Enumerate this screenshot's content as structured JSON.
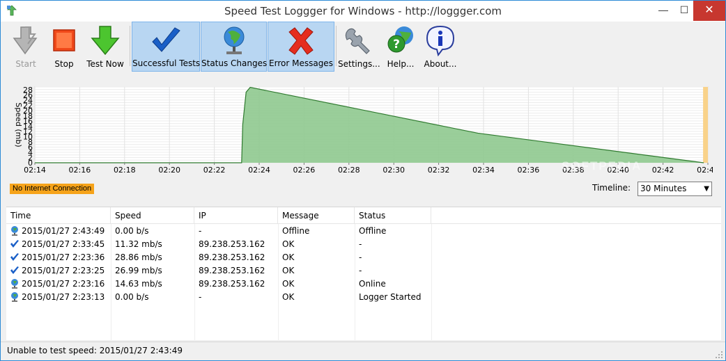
{
  "window": {
    "title": "Speed Test Loggger for Windows - http://loggger.com",
    "min_glyph": "—",
    "max_glyph": "☐",
    "close_glyph": "✕"
  },
  "toolbar": {
    "buttons": [
      {
        "label": "Start",
        "icon": "start-arrow-icon",
        "state": "disabled"
      },
      {
        "label": "Stop",
        "icon": "stop-square-icon",
        "state": "normal"
      },
      {
        "label": "Test Now",
        "icon": "test-now-arrow-icon",
        "state": "normal"
      },
      {
        "label": "Successful Tests",
        "icon": "checkmark-icon",
        "state": "pressed"
      },
      {
        "label": "Status Changes",
        "icon": "globe-network-icon",
        "state": "pressed"
      },
      {
        "label": "Error Messages",
        "icon": "error-x-icon",
        "state": "pressed"
      },
      {
        "label": "Settings...",
        "icon": "wrench-icon",
        "state": "normal"
      },
      {
        "label": "Help...",
        "icon": "help-globe-icon",
        "state": "normal"
      },
      {
        "label": "About...",
        "icon": "info-bubble-icon",
        "state": "normal"
      }
    ]
  },
  "chart_data": {
    "type": "area",
    "ylabel": "Speed (mb)",
    "xlabel": "",
    "y_ticks": [
      0,
      2,
      4,
      6,
      8,
      10,
      12,
      14,
      16,
      18,
      20,
      22,
      24,
      26,
      28
    ],
    "ylim": [
      0,
      29
    ],
    "x_ticks": [
      "02:14",
      "02:16",
      "02:18",
      "02:20",
      "02:22",
      "02:24",
      "02:26",
      "02:28",
      "02:30",
      "02:32",
      "02:34",
      "02:36",
      "02:38",
      "02:40",
      "02:42",
      "02:44"
    ],
    "xlim": [
      "02:14",
      "02:44"
    ],
    "series": [
      {
        "x": [
          "02:14",
          "02:23:13",
          "02:23:16",
          "02:23:25",
          "02:23:36",
          "02:33:45",
          "02:43:49"
        ],
        "y": [
          0,
          0,
          14.63,
          26.99,
          28.86,
          11.32,
          0
        ]
      }
    ],
    "fill_color": "#8fc98f",
    "line_color": "#2f7a2f",
    "highlight_band_color": "#f9d28a",
    "grid": true
  },
  "status_chip": "No Internet Connection",
  "timeline": {
    "label": "Timeline:",
    "value": "30 Minutes"
  },
  "table": {
    "columns": [
      "Time",
      "Speed",
      "IP",
      "Message",
      "Status"
    ],
    "rows": [
      {
        "icon": "globe-icon",
        "time": "2015/01/27 2:43:49",
        "speed": "0.00 b/s",
        "ip": "-",
        "message": "Offline",
        "status": "Offline"
      },
      {
        "icon": "check-icon",
        "time": "2015/01/27 2:33:45",
        "speed": "11.32 mb/s",
        "ip": "89.238.253.162",
        "message": "OK",
        "status": "-"
      },
      {
        "icon": "check-icon",
        "time": "2015/01/27 2:23:36",
        "speed": "28.86 mb/s",
        "ip": "89.238.253.162",
        "message": "OK",
        "status": "-"
      },
      {
        "icon": "check-icon",
        "time": "2015/01/27 2:23:25",
        "speed": "26.99 mb/s",
        "ip": "89.238.253.162",
        "message": "OK",
        "status": "-"
      },
      {
        "icon": "globe-icon",
        "time": "2015/01/27 2:23:16",
        "speed": "14.63 mb/s",
        "ip": "89.238.253.162",
        "message": "OK",
        "status": "Online"
      },
      {
        "icon": "globe-icon",
        "time": "2015/01/27 2:23:13",
        "speed": "0.00 b/s",
        "ip": "-",
        "message": "OK",
        "status": "Logger Started"
      }
    ]
  },
  "statusbar": {
    "text": "Unable to test speed: 2015/01/27 2:43:49"
  }
}
